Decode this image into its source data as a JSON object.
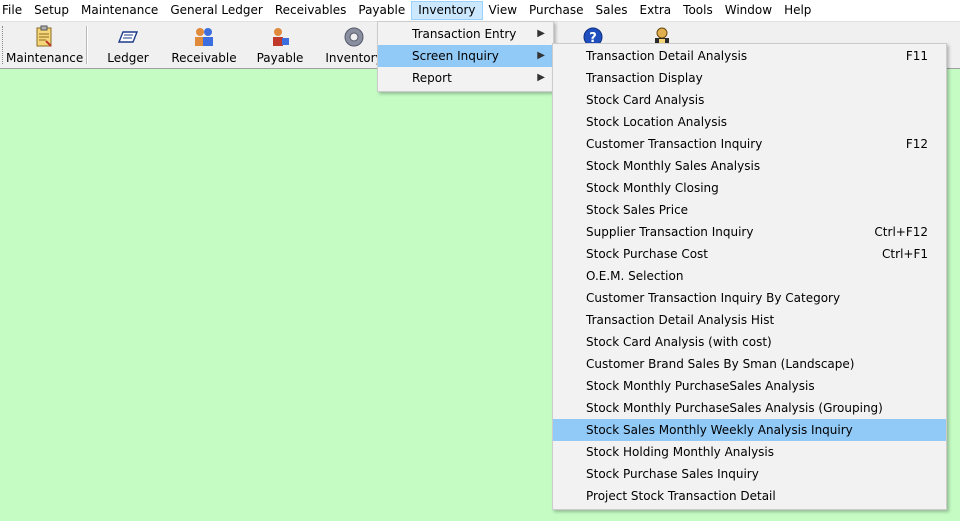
{
  "menubar": {
    "items": [
      "File",
      "Setup",
      "Maintenance",
      "General Ledger",
      "Receivables",
      "Payable",
      "Inventory",
      "View",
      "Purchase",
      "Sales",
      "Extra",
      "Tools",
      "Window",
      "Help"
    ]
  },
  "toolbar": {
    "buttons": [
      {
        "label": "Maintenance",
        "icon": "maintenance-icon"
      },
      {
        "label": "Ledger",
        "icon": "ledger-icon"
      },
      {
        "label": "Receivable",
        "icon": "receivable-icon"
      },
      {
        "label": "Payable",
        "icon": "payable-icon"
      },
      {
        "label": "Inventory",
        "icon": "inventory-gear-icon"
      }
    ],
    "extra_icons": [
      "help-icon",
      "user-icon"
    ]
  },
  "inventory_menu": {
    "items": [
      {
        "label": "Transaction Entry",
        "submenu": true
      },
      {
        "label": "Screen Inquiry",
        "submenu": true,
        "selected": true
      },
      {
        "label": "Report",
        "submenu": true
      }
    ]
  },
  "screen_inquiry_menu": {
    "items": [
      {
        "label": "Transaction Detail Analysis",
        "shortcut": "F11"
      },
      {
        "label": "Transaction Display",
        "shortcut": ""
      },
      {
        "label": "Stock Card Analysis",
        "shortcut": ""
      },
      {
        "label": "Stock Location Analysis",
        "shortcut": ""
      },
      {
        "label": "Customer Transaction Inquiry",
        "shortcut": "F12"
      },
      {
        "label": "Stock Monthly Sales Analysis",
        "shortcut": ""
      },
      {
        "label": "Stock Monthly Closing",
        "shortcut": ""
      },
      {
        "label": "Stock Sales Price",
        "shortcut": ""
      },
      {
        "label": "Supplier Transaction Inquiry",
        "shortcut": "Ctrl+F12"
      },
      {
        "label": "Stock Purchase Cost",
        "shortcut": "Ctrl+F1"
      },
      {
        "label": "O.E.M. Selection",
        "shortcut": ""
      },
      {
        "label": "Customer Transaction Inquiry By Category",
        "shortcut": ""
      },
      {
        "label": "Transaction Detail Analysis Hist",
        "shortcut": ""
      },
      {
        "label": "Stock Card Analysis (with cost)",
        "shortcut": ""
      },
      {
        "label": "Customer Brand Sales By Sman (Landscape)",
        "shortcut": ""
      },
      {
        "label": "Stock Monthly PurchaseSales Analysis",
        "shortcut": ""
      },
      {
        "label": "Stock Monthly PurchaseSales Analysis (Grouping)",
        "shortcut": ""
      },
      {
        "label": "Stock Sales Monthly Weekly Analysis Inquiry",
        "shortcut": "",
        "highlighted": true
      },
      {
        "label": "Stock Holding Monthly Analysis",
        "shortcut": ""
      },
      {
        "label": "Stock Purchase Sales Inquiry",
        "shortcut": ""
      },
      {
        "label": "Project Stock Transaction Detail",
        "shortcut": ""
      }
    ]
  },
  "colors": {
    "desktop": "#c4fcc4",
    "menu_highlight": "#91c9f7",
    "menubar_active": "#cce8ff"
  }
}
